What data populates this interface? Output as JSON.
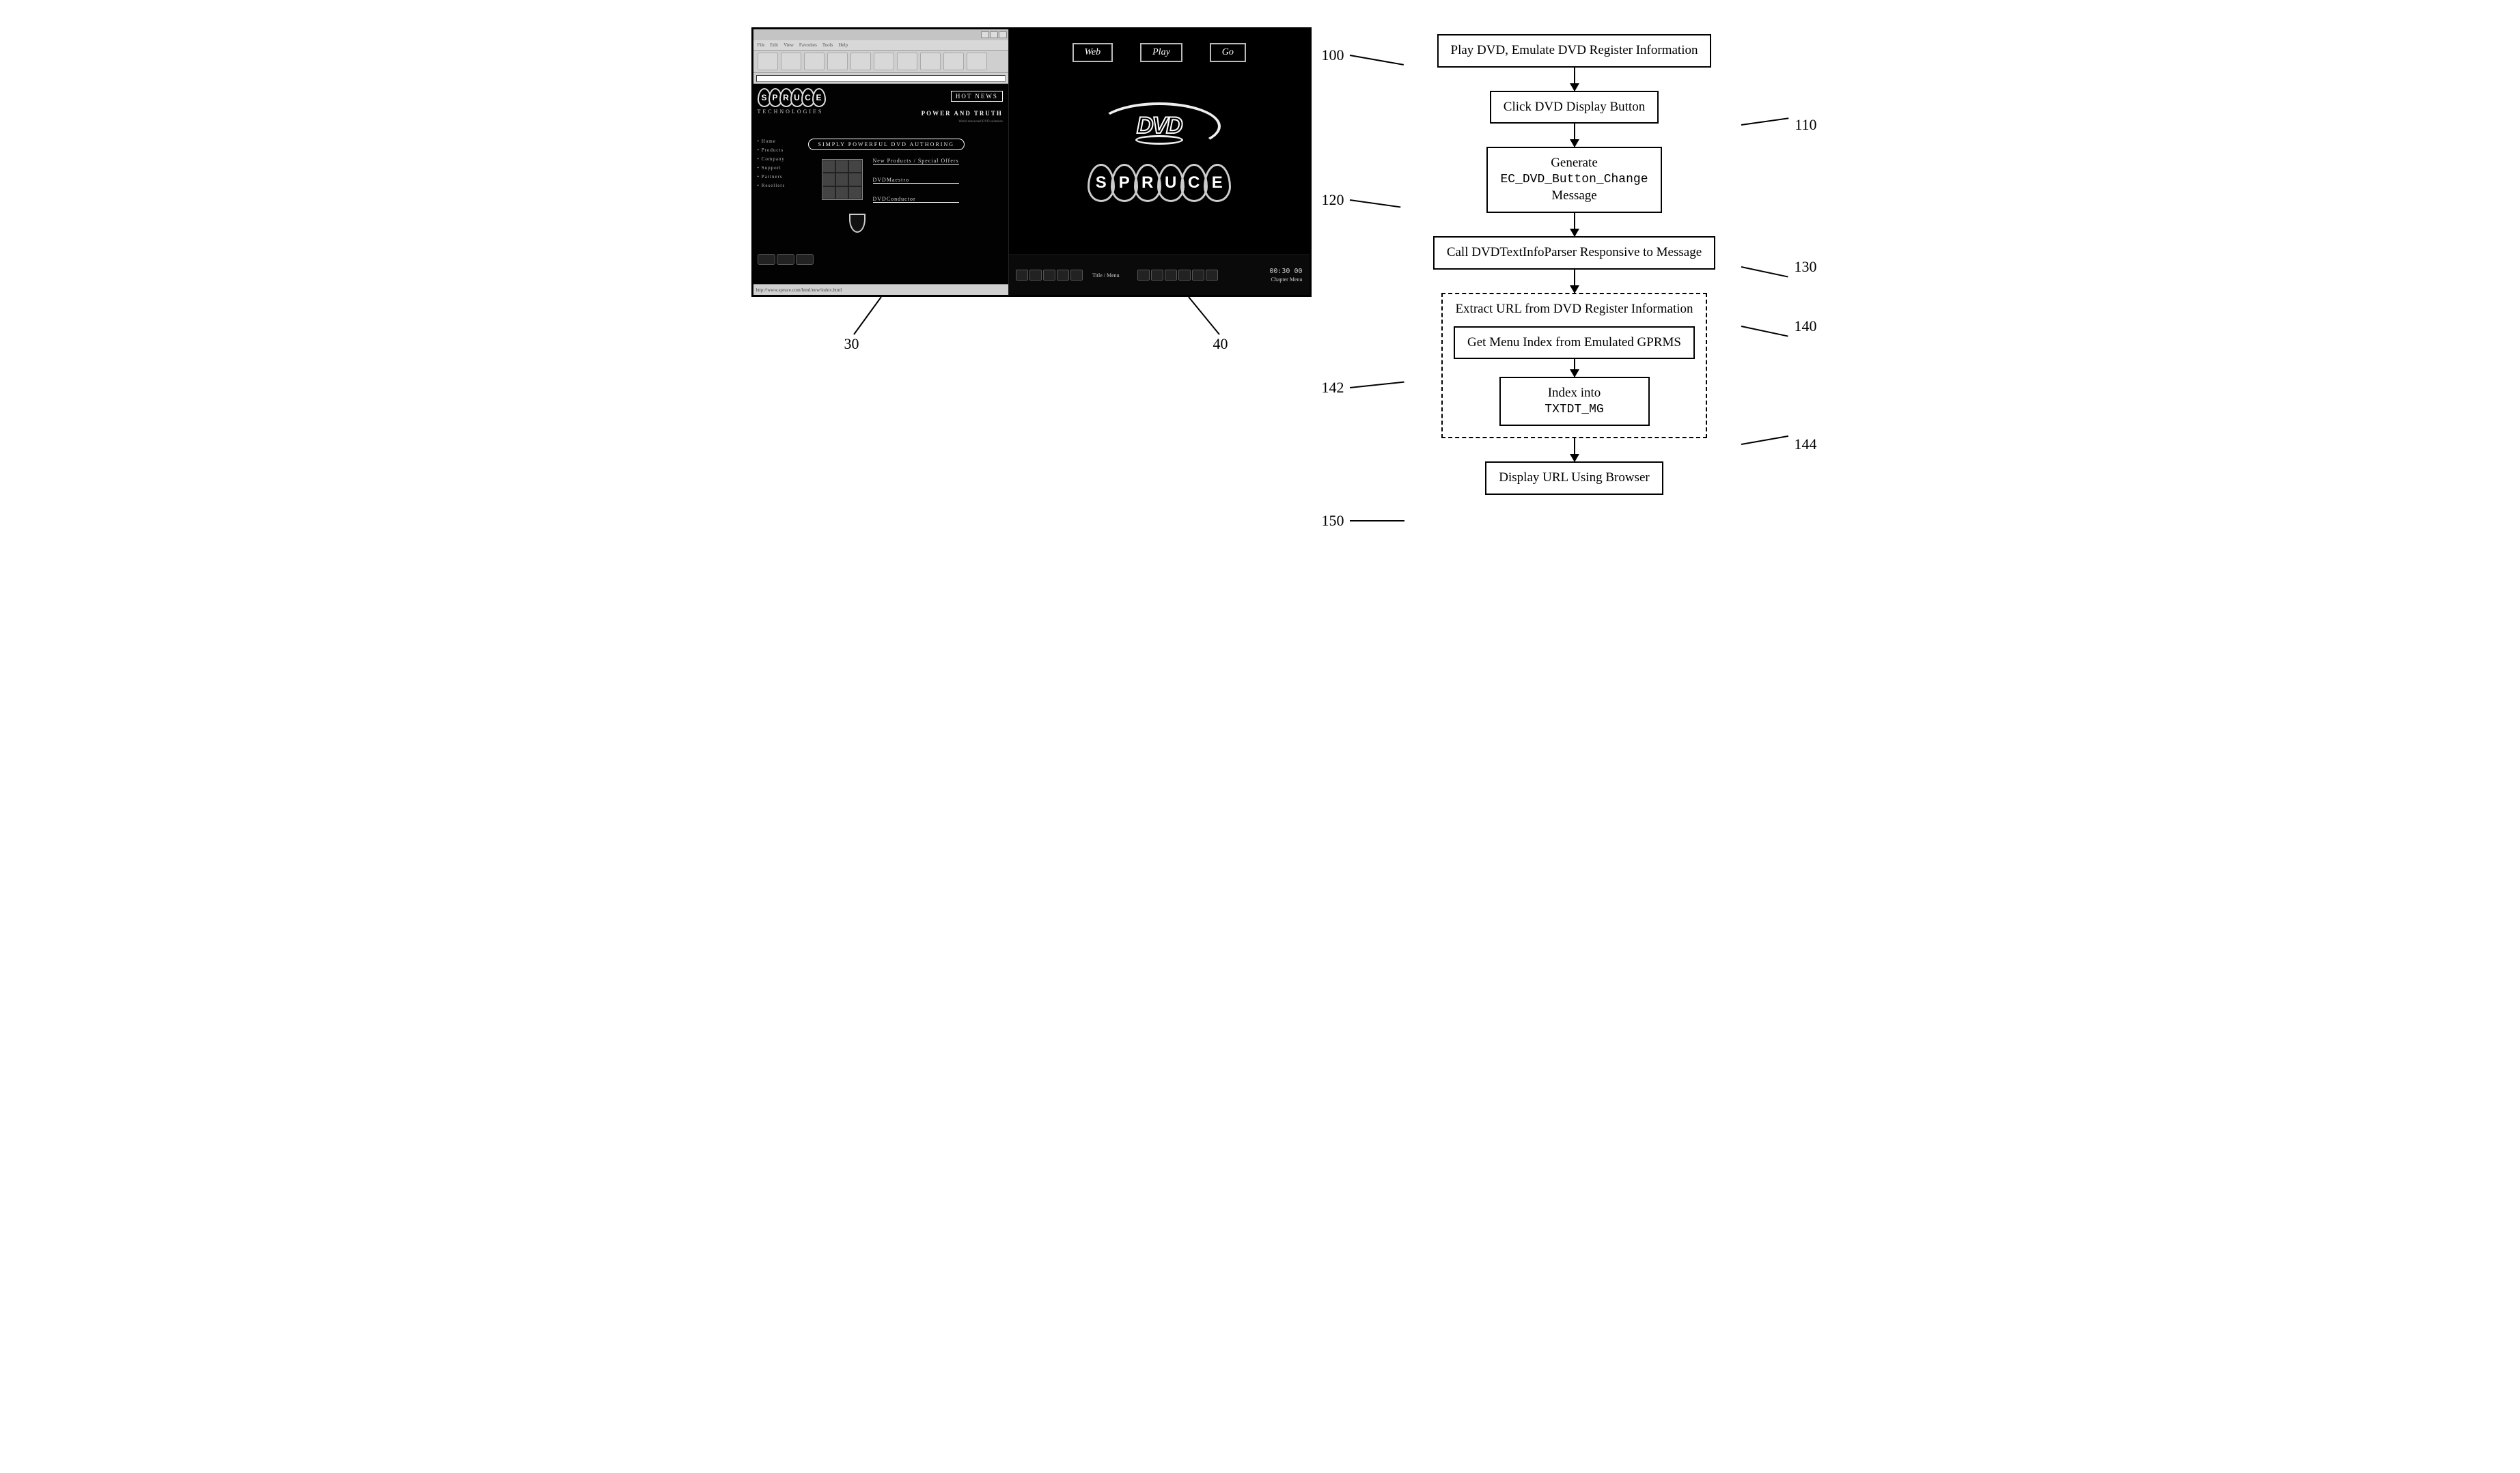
{
  "left": {
    "callout_browser": "30",
    "callout_player": "40",
    "browser": {
      "menus": [
        "File",
        "Edit",
        "View",
        "Favorites",
        "Tools",
        "Help"
      ],
      "brand_letters": [
        "S",
        "P",
        "R",
        "U",
        "C",
        "E"
      ],
      "brand_sub": "TECHNOLOGIES",
      "hot_news": "HOT NEWS",
      "headline": "POWER AND TRUTH",
      "banner": "SIMPLY POWERFUL DVD AUTHORING",
      "nav_links": [
        "• Home",
        "• Products",
        "• Company",
        "• Support",
        "• Partners",
        "• Resellers"
      ],
      "section1": "New Products / Special Offers",
      "section2": "DVDMaestro",
      "section3": "DVDConductor",
      "status": "http://www.spruce.com/html/new/index.html"
    },
    "player": {
      "menu_buttons": [
        "Web",
        "Play",
        "Go"
      ],
      "logo_text": "DVD",
      "brand_letters": [
        "S",
        "P",
        "R",
        "U",
        "C",
        "E"
      ],
      "timecode": "00:30 00",
      "label_title": "Title / Menu",
      "label_chapter": "Chapter Menu"
    }
  },
  "flow": {
    "100": {
      "ref": "100",
      "text": "Play DVD, Emulate DVD Register Information"
    },
    "110": {
      "ref": "110",
      "text": "Click DVD Display Button"
    },
    "120": {
      "ref": "120",
      "prefix": "Generate",
      "code": "EC_DVD_Button_Change",
      "suffix": "Message"
    },
    "130": {
      "ref": "130",
      "text": "Call DVDTextInfoParser Responsive to Message"
    },
    "140": {
      "ref": "140",
      "title": "Extract URL from DVD Register Information"
    },
    "142": {
      "ref": "142",
      "text": "Get Menu Index from Emulated GPRMS"
    },
    "144": {
      "ref": "144",
      "prefix": "Index into",
      "code": "TXTDT_MG"
    },
    "150": {
      "ref": "150",
      "text": "Display URL Using Browser"
    }
  }
}
